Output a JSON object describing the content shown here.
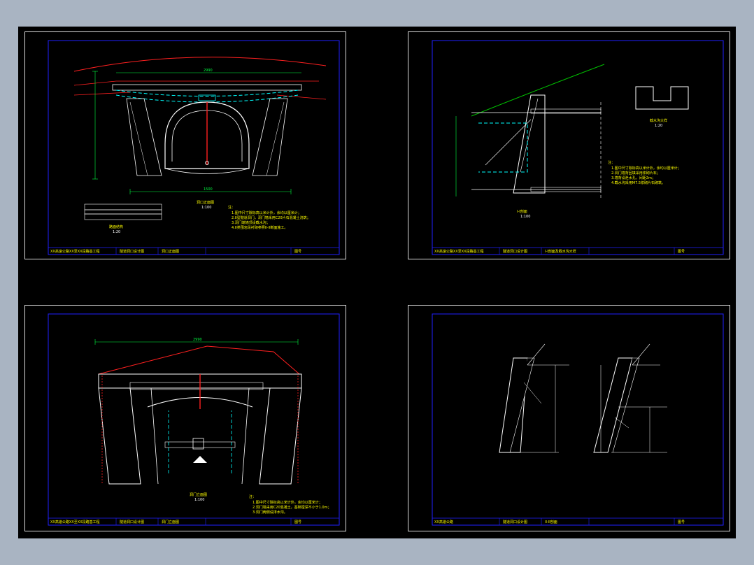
{
  "colors": {
    "background": "#a9b4c2",
    "canvas": "#000000",
    "sheet_border": "#dcdcdc",
    "drawing_frame": "#2020ff",
    "structure": "#ffffff",
    "dimension": "#00ff40",
    "note_text": "#ffff00",
    "centerline": "#ff2020",
    "dashed_rebar": "#00ffff",
    "slope_line": "#00c000"
  },
  "sheets": [
    {
      "id": "top-left",
      "main_view": "elevation with tunnel arch",
      "labels": {
        "title": "洞口正面图",
        "scale": "1:100",
        "section_title": "路面结构",
        "section_scale": "1:20",
        "dim_bottom": "1500",
        "dim_top": "2990",
        "notes_head": "注：",
        "note1": "1.图中尺寸除标高以米计外，余均以厘米计；",
        "note2": "2.II型隧道洞门，洞门墙采用C20片石混凝土浇筑；",
        "note3": "3.洞门端墙顶设截水沟；",
        "note4": "4.II类围岩段衬砌参照II-II断面施工。",
        "tb_project": "XX高速公路XX至XX段路基工程",
        "tb_drawing": "隧道洞口设计图",
        "tb_view": "洞口正面图",
        "tb_no": "图号"
      }
    },
    {
      "id": "top-right",
      "main_view": "section I-I",
      "labels": {
        "title": "I-I剖面",
        "scale": "1:100",
        "detail_title": "截水沟大样",
        "detail_scale": "1:20",
        "notes_head": "注：",
        "note1": "1.图中尺寸除标高以米计外，余均以厘米计；",
        "note2": "2.洞门墙背回填采用浆砌片石；",
        "note3": "3.墙背设泄水孔，间距2m；",
        "note4": "4.截水沟采用M7.5浆砌片石砌筑。",
        "tb_project": "XX高速公路XX至XX段路基工程",
        "tb_drawing": "隧道洞口设计图",
        "tb_view": "I-I剖面及截水沟大样",
        "tb_no": "图号"
      }
    },
    {
      "id": "bottom-left",
      "main_view": "front elevation",
      "labels": {
        "title": "洞门立面图",
        "scale": "1:100",
        "dim_top": "2990",
        "notes_head": "注：",
        "note1": "1.图中尺寸除标高以米计外，余均以厘米计；",
        "note2": "2.洞门墙采用C20混凝土，基础埋深不小于1.0m；",
        "note3": "3.洞门两侧设排水沟。",
        "tb_project": "XX高速公路XX至XX段路基工程",
        "tb_drawing": "隧道洞口设计图",
        "tb_view": "洞门立面图",
        "tb_no": "图号"
      }
    },
    {
      "id": "bottom-right",
      "main_view": "two wall sections",
      "labels": {
        "tb_project": "XX高速公路",
        "tb_drawing": "隧道洞口设计图",
        "tb_view": "II-II剖面",
        "tb_no": "图号"
      }
    }
  ]
}
